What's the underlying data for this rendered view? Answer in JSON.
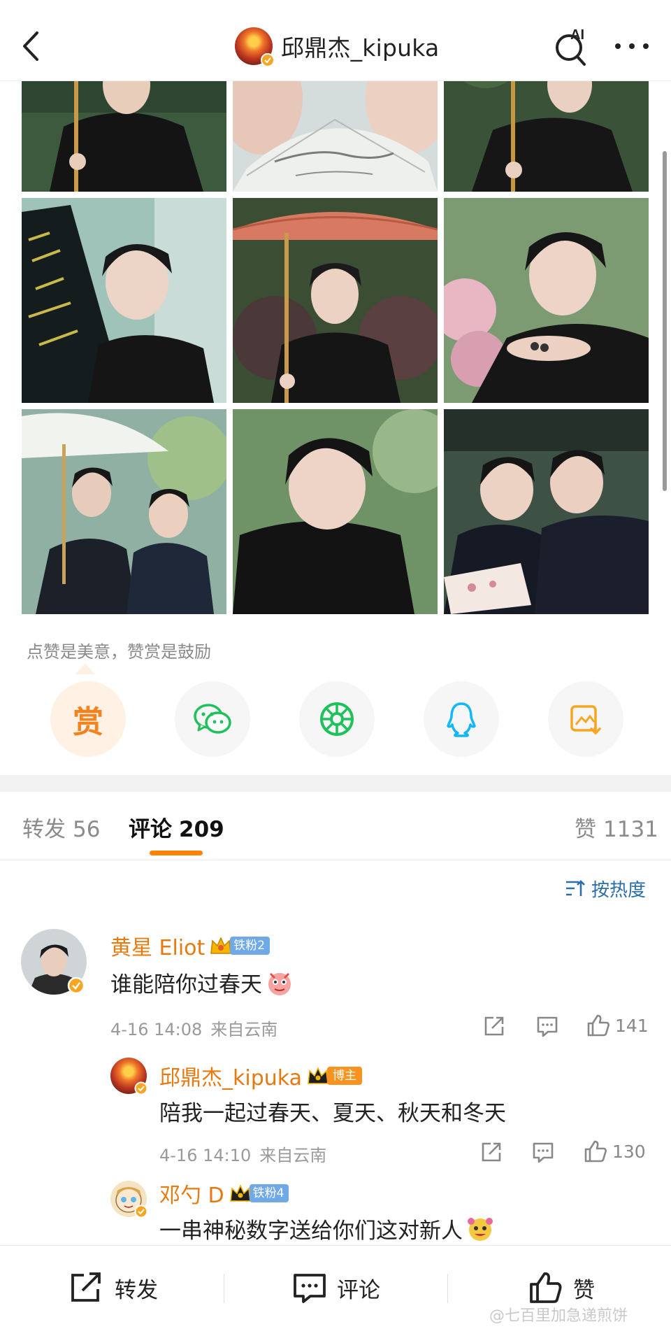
{
  "header": {
    "title": "邱鼎杰_kipuka",
    "ai_label": "AI",
    "icons": [
      "back-arrow-icon",
      "ai-search-icon",
      "more-icon"
    ]
  },
  "photos": {
    "count": 9
  },
  "reward": {
    "caption": "点赞是美意，赞赏是鼓励",
    "reward_label": "赏",
    "share_targets": [
      "reward",
      "wechat-icon",
      "moments-icon",
      "qq-icon",
      "save-image-icon"
    ]
  },
  "tabs": {
    "repost": {
      "label": "转发",
      "count": "56"
    },
    "comment": {
      "label": "评论",
      "count": "209"
    },
    "like": {
      "label": "赞",
      "count": "1131"
    }
  },
  "sort": {
    "label": "按热度"
  },
  "comments": [
    {
      "name": "黄星 Eliot",
      "badge": "铁粉2",
      "text": "谁能陪你过春天",
      "time": "4-16 14:08",
      "source": "来自云南",
      "likes": "141"
    },
    {
      "name": "邱鼎杰_kipuka",
      "badge": "博主",
      "text": "陪我一起过春天、夏天、秋天和冬天",
      "time": "4-16 14:10",
      "source": "来自云南",
      "likes": "130"
    },
    {
      "name": "邓勺 D",
      "badge": "铁粉4",
      "text": "一串神秘数字送给你们这对新人"
    }
  ],
  "bottom_bar": {
    "repost": "转发",
    "comment": "评论",
    "like": "赞"
  },
  "watermark": "@七百里加急递煎饼",
  "colors": {
    "accent_orange": "#ff8200",
    "name_orange": "#e8790e",
    "fan_blue": "#70a9e8",
    "link_blue": "#2b6ea8",
    "wechat_green": "#1fc15b",
    "qq_blue": "#12b7f5"
  }
}
